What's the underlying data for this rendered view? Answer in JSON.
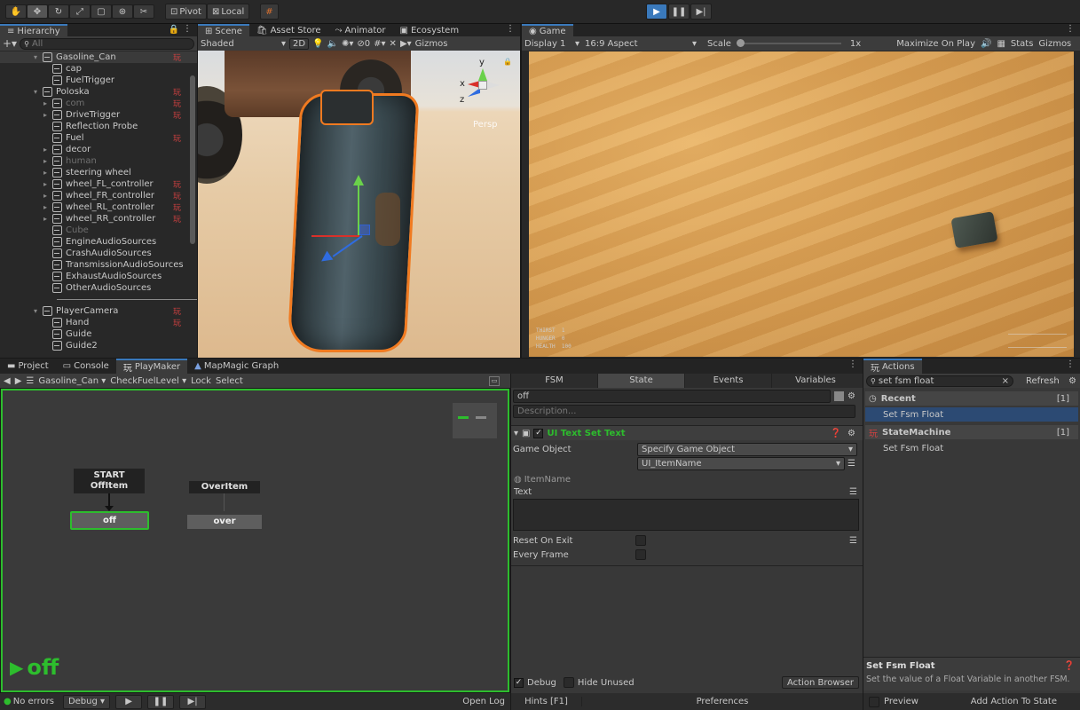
{
  "toolbar": {
    "pivot_label": "Pivot",
    "local_label": "Local"
  },
  "hierarchy": {
    "tab_label": "Hierarchy",
    "search_placeholder": "All",
    "items": [
      {
        "label": "Gasoline_Can",
        "indent": 0,
        "arrow": "▾",
        "pm": true,
        "dim": false,
        "selected": true
      },
      {
        "label": "cap",
        "indent": 1,
        "arrow": "",
        "pm": false,
        "dim": false
      },
      {
        "label": "FuelTrigger",
        "indent": 1,
        "arrow": "",
        "pm": false,
        "dim": false
      },
      {
        "label": "Poloska",
        "indent": 0,
        "arrow": "▾",
        "pm": true,
        "dim": false
      },
      {
        "label": "com",
        "indent": 1,
        "arrow": "▸",
        "pm": true,
        "dim": true
      },
      {
        "label": "DriveTrigger",
        "indent": 1,
        "arrow": "▸",
        "pm": true,
        "dim": false
      },
      {
        "label": "Reflection Probe",
        "indent": 1,
        "arrow": "",
        "pm": false,
        "dim": false
      },
      {
        "label": "Fuel",
        "indent": 1,
        "arrow": "",
        "pm": true,
        "dim": false
      },
      {
        "label": "decor",
        "indent": 1,
        "arrow": "▸",
        "pm": false,
        "dim": false
      },
      {
        "label": "human",
        "indent": 1,
        "arrow": "▸",
        "pm": false,
        "dim": true
      },
      {
        "label": "steering wheel",
        "indent": 1,
        "arrow": "▸",
        "pm": false,
        "dim": false
      },
      {
        "label": "wheel_FL_controller",
        "indent": 1,
        "arrow": "▸",
        "pm": true,
        "dim": false
      },
      {
        "label": "wheel_FR_controller",
        "indent": 1,
        "arrow": "▸",
        "pm": true,
        "dim": false
      },
      {
        "label": "wheel_RL_controller",
        "indent": 1,
        "arrow": "▸",
        "pm": true,
        "dim": false
      },
      {
        "label": "wheel_RR_controller",
        "indent": 1,
        "arrow": "▸",
        "pm": true,
        "dim": false
      },
      {
        "label": "Cube",
        "indent": 1,
        "arrow": "",
        "pm": false,
        "dim": true
      },
      {
        "label": "EngineAudioSources",
        "indent": 1,
        "arrow": "",
        "pm": false,
        "dim": false
      },
      {
        "label": "CrashAudioSources",
        "indent": 1,
        "arrow": "",
        "pm": false,
        "dim": false
      },
      {
        "label": "TransmissionAudioSources",
        "indent": 1,
        "arrow": "",
        "pm": false,
        "dim": false
      },
      {
        "label": "ExhaustAudioSources",
        "indent": 1,
        "arrow": "",
        "pm": false,
        "dim": false
      },
      {
        "label": "OtherAudioSources",
        "indent": 1,
        "arrow": "",
        "pm": false,
        "dim": false
      },
      {
        "label": "",
        "indent": 0,
        "arrow": "",
        "pm": false,
        "dim": false,
        "separator": true
      },
      {
        "label": "PlayerCamera",
        "indent": 0,
        "arrow": "▾",
        "pm": true,
        "dim": false
      },
      {
        "label": "Hand",
        "indent": 1,
        "arrow": "",
        "pm": true,
        "dim": false
      },
      {
        "label": "Guide",
        "indent": 1,
        "arrow": "",
        "pm": false,
        "dim": false
      },
      {
        "label": "Guide2",
        "indent": 1,
        "arrow": "",
        "pm": false,
        "dim": false
      }
    ]
  },
  "scene": {
    "tabs": [
      "Scene",
      "Asset Store",
      "Animator",
      "Ecosystem"
    ],
    "shading": "Shaded",
    "mode_2d": "2D",
    "fx_count": "0",
    "gizmos": "Gizmos",
    "persp": "Persp",
    "axis_y": "y",
    "axis_x": "x",
    "axis_z": "z"
  },
  "game": {
    "tab_label": "Game",
    "display": "Display 1",
    "aspect": "16:9 Aspect",
    "scale_label": "Scale",
    "scale_value": "1x",
    "maximize": "Maximize On Play",
    "stats": "Stats",
    "gizmos": "Gizmos"
  },
  "bottom_tabs": [
    "Project",
    "Console",
    "PlayMaker",
    "MapMagic Graph"
  ],
  "playmaker": {
    "object": "Gasoline_Can",
    "fsm": "CheckFuelLevel",
    "lock": "Lock",
    "select": "Select",
    "nodes": {
      "start_title_1": "START",
      "start_title_2": "OffItem",
      "start_state": "off",
      "over_title": "OverItem",
      "over_state": "over"
    },
    "current_state": "off",
    "status": {
      "errors": "No errors",
      "debug": "Debug",
      "open_log": "Open Log"
    }
  },
  "inspector": {
    "tabs": [
      "FSM",
      "State",
      "Events",
      "Variables"
    ],
    "state_name": "off",
    "description_placeholder": "Description...",
    "action_title": "UI Text Set Text",
    "game_object_label": "Game Object",
    "game_object_value": "Specify Game Object",
    "ui_item": "UI_ItemName",
    "item_name_label": "ItemName",
    "text_label": "Text",
    "reset_on_exit": "Reset On Exit",
    "every_frame": "Every Frame",
    "debug_label": "Debug",
    "hide_unused_label": "Hide Unused",
    "action_browser": "Action Browser",
    "hints": "Hints [F1]",
    "preferences": "Preferences"
  },
  "actions": {
    "tab_label": "Actions",
    "search_value": "set fsm float",
    "refresh": "Refresh",
    "recent_label": "Recent",
    "recent_count": "[1]",
    "recent_item": "Set Fsm Float",
    "sm_label": "StateMachine",
    "sm_count": "[1]",
    "sm_item": "Set Fsm Float",
    "detail_title": "Set Fsm Float",
    "detail_desc": "Set the value of a Float Variable in another FSM.",
    "preview": "Preview",
    "add_action": "Add Action To State"
  },
  "hud": {
    "thirst": "THIRST",
    "hunger": "HUNGER",
    "health": "HEALTH",
    "hud_v1": "1",
    "hud_v2": "0",
    "hud_v3": "100"
  },
  "colors": {
    "accent": "#3a79bb",
    "fsm_green": "#2dbd2d",
    "playmaker_red": "#d04040",
    "selection": "#2c4a73"
  }
}
